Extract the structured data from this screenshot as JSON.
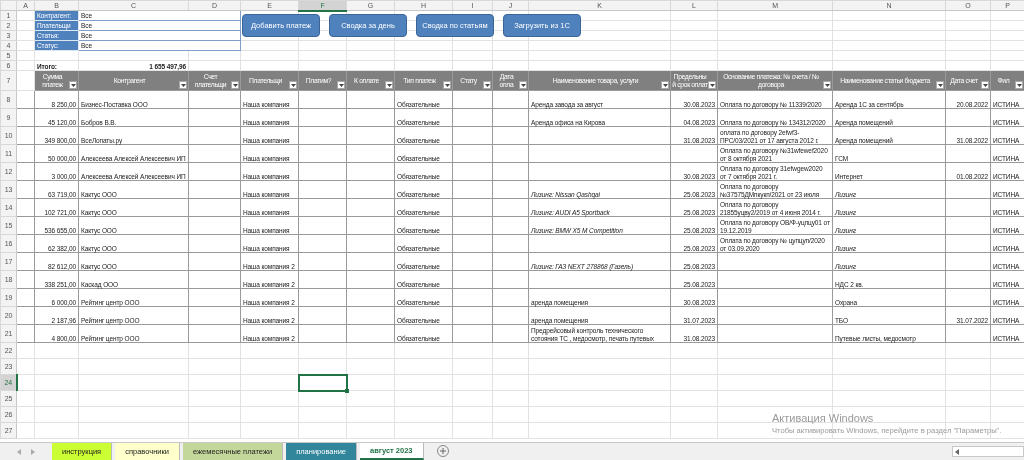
{
  "sheet": {
    "column_headers": [
      {
        "label": "A",
        "selected": false
      },
      {
        "label": "B",
        "selected": false
      },
      {
        "label": "C",
        "selected": false
      },
      {
        "label": "D",
        "selected": false
      },
      {
        "label": "E",
        "selected": false
      },
      {
        "label": "F",
        "selected": true
      },
      {
        "label": "G",
        "selected": false
      },
      {
        "label": "H",
        "selected": false
      },
      {
        "label": "I",
        "selected": false
      },
      {
        "label": "J",
        "selected": false
      },
      {
        "label": "K",
        "selected": false
      },
      {
        "label": "L",
        "selected": false
      },
      {
        "label": "M",
        "selected": false
      },
      {
        "label": "N",
        "selected": false
      },
      {
        "label": "O",
        "selected": false
      },
      {
        "label": "P",
        "selected": false
      }
    ],
    "row_numbers": [
      {
        "label": "1",
        "selected": false
      },
      {
        "label": "2",
        "selected": false
      },
      {
        "label": "3",
        "selected": false
      },
      {
        "label": "4",
        "selected": false
      },
      {
        "label": "5",
        "selected": false
      },
      {
        "label": "6",
        "selected": false
      },
      {
        "label": "7",
        "selected": false
      },
      {
        "label": "8",
        "selected": false
      },
      {
        "label": "9",
        "selected": false
      },
      {
        "label": "10",
        "selected": false
      },
      {
        "label": "11",
        "selected": false
      },
      {
        "label": "12",
        "selected": false
      },
      {
        "label": "13",
        "selected": false
      },
      {
        "label": "14",
        "selected": false
      },
      {
        "label": "15",
        "selected": false
      },
      {
        "label": "16",
        "selected": false
      },
      {
        "label": "17",
        "selected": false
      },
      {
        "label": "18",
        "selected": false
      },
      {
        "label": "19",
        "selected": false
      },
      {
        "label": "20",
        "selected": false
      },
      {
        "label": "21",
        "selected": false
      },
      {
        "label": "22",
        "selected": false
      },
      {
        "label": "23",
        "selected": false
      },
      {
        "label": "24",
        "selected": true
      },
      {
        "label": "25",
        "selected": false
      },
      {
        "label": "26",
        "selected": false
      },
      {
        "label": "27",
        "selected": false
      }
    ],
    "filters": [
      {
        "label": "Контрагент:",
        "value": "Все"
      },
      {
        "label": "Плательщи",
        "value": "Все"
      },
      {
        "label": "Статья:",
        "value": "Все"
      },
      {
        "label": "Статус:",
        "value": "Все"
      }
    ],
    "total": {
      "label": "Итого:",
      "value": "1 655 497,96"
    },
    "buttons": [
      "Добавить платеж",
      "Сводка за день",
      "Сводка по статьям",
      "Загрузить из 1С"
    ],
    "table_headers": [
      "Сумма платеж",
      "Контрагент",
      "Счет плательщи",
      "Плательщи",
      "Платим?",
      "К оплате",
      "Тип платеж",
      "Стату",
      "Дата опла",
      "Наименование товара, услуги",
      "Предельный срок оплат",
      "Основание платежа: № счета / № договора",
      "Наименование статьи бюджета",
      "Дата счет",
      "Фил"
    ],
    "rows": [
      {
        "amount": "8 250,00",
        "counterparty": "Бизнес-Поставка ООО",
        "payer": "Наша компания",
        "payment_type": "Обязательные",
        "product": "Аренда завода за август",
        "deadline": "30.08.2023",
        "basis": "Оплата по договору № 11339/2020",
        "budget_item": "Аренда 1С за сентябрь",
        "invoice_date": "20.08.2022",
        "filter": "ИСТИНА",
        "leasing": false
      },
      {
        "amount": "45 120,00",
        "counterparty": "Бобров В.В.",
        "payer": "Наша компания",
        "payment_type": "Обязательные",
        "product": "Аренда офиса на Кирова",
        "deadline": "04.08.2023",
        "basis": "Оплата по договору № 134312/2020",
        "budget_item": "Аренда помещений",
        "filter": "ИСТИНА",
        "leasing": false
      },
      {
        "amount": "349 800,00",
        "counterparty": "ВсеЛопаты.ру",
        "payer": "Наша компания",
        "payment_type": "Обязательные",
        "deadline": "31.08.2023",
        "basis": "оплата по договору 2efwf3-ПРС/03/2021 от 17 августа 2012 г.",
        "budget_item": "Аренда помещений",
        "invoice_date": "31.08.2022",
        "filter": "ИСТИНА",
        "leasing": false
      },
      {
        "amount": "50 000,00",
        "counterparty": "Алексеева Алексей Алексеевич ИП",
        "payer": "Наша компания",
        "payment_type": "Обязательные",
        "basis": "Оплата по договору №31wfewef2020 от 8 октября 2021",
        "budget_item": "ГСМ",
        "filter": "ИСТИНА",
        "leasing": false
      },
      {
        "amount": "3 000,00",
        "counterparty": "Алексеева Алексей Алексеевич ИП",
        "payer": "Наша компания",
        "payment_type": "Обязательные",
        "deadline": "30.08.2023",
        "basis": "Оплата по договору 31efwgew2020 от 7 октября 2021 г.",
        "budget_item": "Интернет",
        "invoice_date": "01.08.2022",
        "filter": "ИСТИНА",
        "leasing": false
      },
      {
        "amount": "63 719,00",
        "counterparty": "Кактус ООО",
        "payer": "Наша компания",
        "payment_type": "Обязательные",
        "product": "Лизинг: Nissan Qashqai",
        "deadline": "25.08.2023",
        "basis": "Оплата по договору №37575ДМпкукп/2021 от 23 июля",
        "budget_item": "Лизинг",
        "filter": "ИСТИНА",
        "leasing": true
      },
      {
        "amount": "102 721,00",
        "counterparty": "Кактус ООО",
        "payer": "Наша компания",
        "payment_type": "Обязательные",
        "product": "Лизинг: AUDI A5 Sportback",
        "deadline": "25.08.2023",
        "basis": "Оплата по договору 21855уцву2/2019 от 4 июня 2014 г.",
        "budget_item": "Лизинг",
        "filter": "ИСТИНА",
        "leasing": true
      },
      {
        "amount": "536 655,00",
        "counterparty": "Кактус ООО",
        "payer": "Наша компания",
        "payment_type": "Обязательные",
        "product": "Лизинг: BMW X5 M Competition",
        "deadline": "25.08.2023",
        "basis": "Оплата по договору ОВ/Ф-уцпцу01 от 19.12.2019",
        "budget_item": "Лизинг",
        "filter": "ИСТИНА",
        "leasing": true
      },
      {
        "amount": "62 382,00",
        "counterparty": "Кактус ООО",
        "payer": "Наша компания",
        "payment_type": "Обязательные",
        "deadline": "25.08.2023",
        "basis": "Оплата по договору № цупцуп/2020 от 03.09.2020",
        "budget_item": "Лизинг",
        "filter": "ИСТИНА",
        "leasing": true
      },
      {
        "amount": "82 612,00",
        "counterparty": "Кактус ООО",
        "payer": "Наша компания 2",
        "payment_type": "Обязательные",
        "product": "Лизинг: ГАЗ NEXT 278868 (Газель)",
        "deadline": "25.08.2023",
        "budget_item": "Лизинг",
        "filter": "ИСТИНА",
        "leasing": true
      },
      {
        "amount": "338 251,00",
        "counterparty": "Каскад ООО",
        "payer": "Наша компания 2",
        "payment_type": "Обязательные",
        "deadline": "25.08.2023",
        "budget_item": "НДС 2 кв.",
        "filter": "ИСТИНА",
        "leasing": false
      },
      {
        "amount": "6 000,00",
        "counterparty": "Рейтинг центр ООО",
        "payer": "Наша компания 2",
        "payment_type": "Обязательные",
        "product": "аренда помещения",
        "deadline": "30.08.2023",
        "budget_item": "Охрана",
        "filter": "ИСТИНА",
        "leasing": false
      },
      {
        "amount": "2 187,96",
        "counterparty": "Рейтинг центр ООО",
        "payer": "Наша компания 2",
        "payment_type": "Обязательные",
        "product": "аренда помещения",
        "deadline": "31.07.2023",
        "budget_item": "ТБО",
        "invoice_date": "31.07.2022",
        "filter": "ИСТИНА",
        "leasing": false
      },
      {
        "amount": "4 800,00",
        "counterparty": "Рейтинг центр ООО",
        "payer": "Наша компания 2",
        "payment_type": "Обязательные",
        "product": "Предрейсовый контроль технического сотояния ТС , медосмотр, печать путевых",
        "deadline": "31.08.2023",
        "budget_item": "Путевые листы, медосмотр",
        "filter": "ИСТИНА",
        "leasing": false
      }
    ]
  },
  "sheet_tabs": [
    {
      "label": "инструкция",
      "color": "#ccff33",
      "selected": false
    },
    {
      "label": "справочники",
      "color": "#ffffcc",
      "selected": false
    },
    {
      "label": "ежемесячные платежи",
      "color": "#c4d79b",
      "selected": false
    },
    {
      "label": "планирование",
      "color": "#31869b",
      "selected": false
    },
    {
      "label": "август 2023",
      "color": "#ffffff",
      "selected": true
    }
  ],
  "os_notice": {
    "title": "Активация Windows",
    "text": "Чтобы активировать Windows, перейдите в раздел \"Параметры\"."
  }
}
